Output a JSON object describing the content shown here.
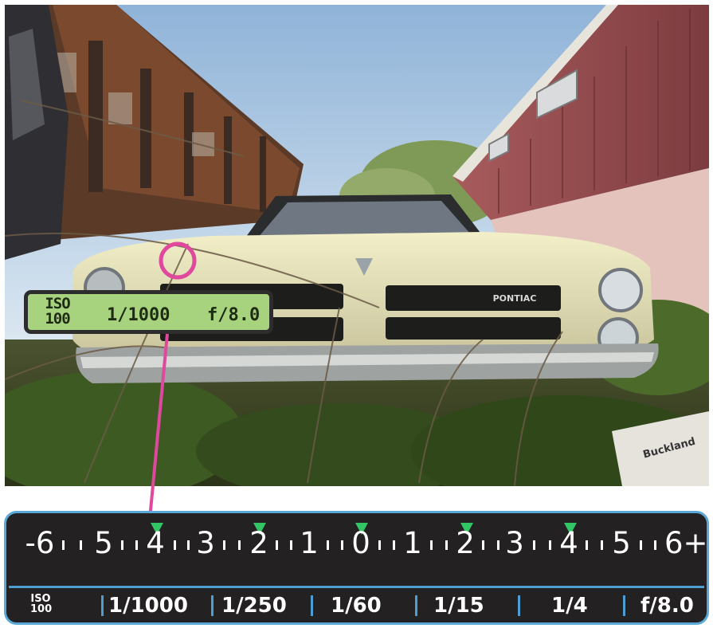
{
  "photo": {
    "subject": "abandoned Pontiac car among weeds",
    "badge_text": "PONTIAC",
    "crate_text": "Buckland"
  },
  "readout": {
    "iso_label": "ISO",
    "iso_value": "100",
    "shutter": "1/1000",
    "aperture": "f/8.0",
    "background_color": "#a7d27e"
  },
  "focus_ring_color": "#e0489e",
  "scale": {
    "stops": [
      "-6",
      "5",
      "4",
      "3",
      "2",
      "1",
      "0",
      "1",
      "2",
      "3",
      "4",
      "5",
      "6+"
    ],
    "marked_stops": [
      "-4",
      "-2",
      "0",
      "+2",
      "+4"
    ],
    "selected_stop": "-4",
    "iso_label": "ISO",
    "iso_value": "100",
    "shutter_speeds": [
      "1/1000",
      "1/250",
      "1/60",
      "1/15",
      "1/4"
    ],
    "aperture": "f/8.0",
    "marker_color": "#33c466",
    "accent_color": "#4d9fd3"
  }
}
